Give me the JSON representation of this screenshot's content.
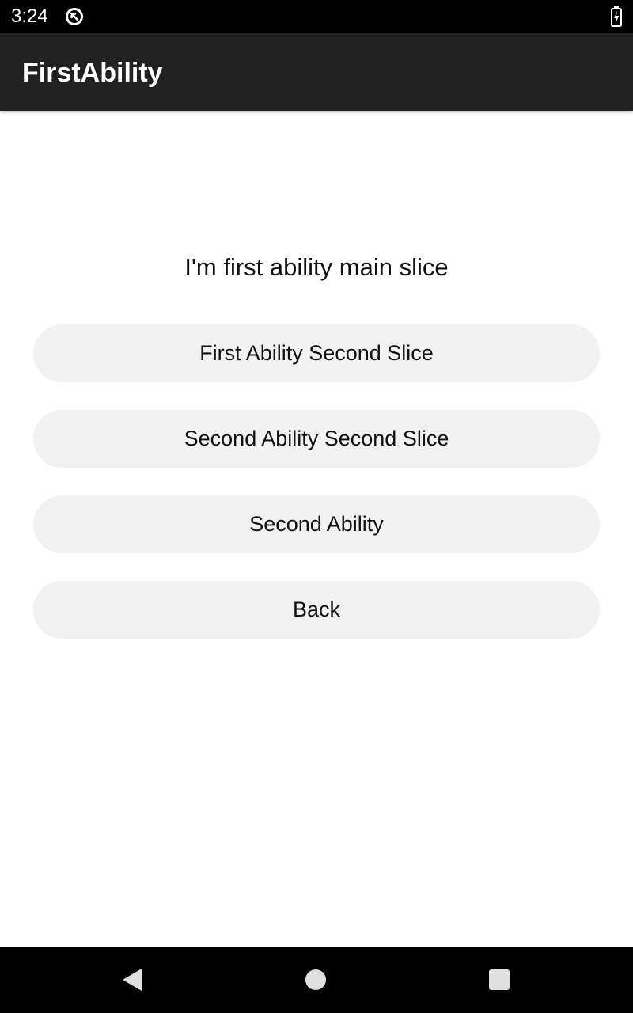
{
  "status_bar": {
    "time": "3:24",
    "icons": [
      "app-notification-icon",
      "battery-charging-icon"
    ]
  },
  "app_bar": {
    "title": "FirstAbility"
  },
  "main": {
    "text": "I'm first ability main slice",
    "buttons": [
      {
        "label": "First Ability Second Slice"
      },
      {
        "label": "Second Ability Second Slice"
      },
      {
        "label": "Second Ability"
      },
      {
        "label": "Back"
      }
    ]
  },
  "nav_bar": {
    "icons": [
      "back-icon",
      "home-icon",
      "recents-icon"
    ]
  },
  "colors": {
    "status_bar": "#000000",
    "app_bar": "#212121",
    "button_bg": "#f1f1f1",
    "nav_bar": "#000000"
  }
}
